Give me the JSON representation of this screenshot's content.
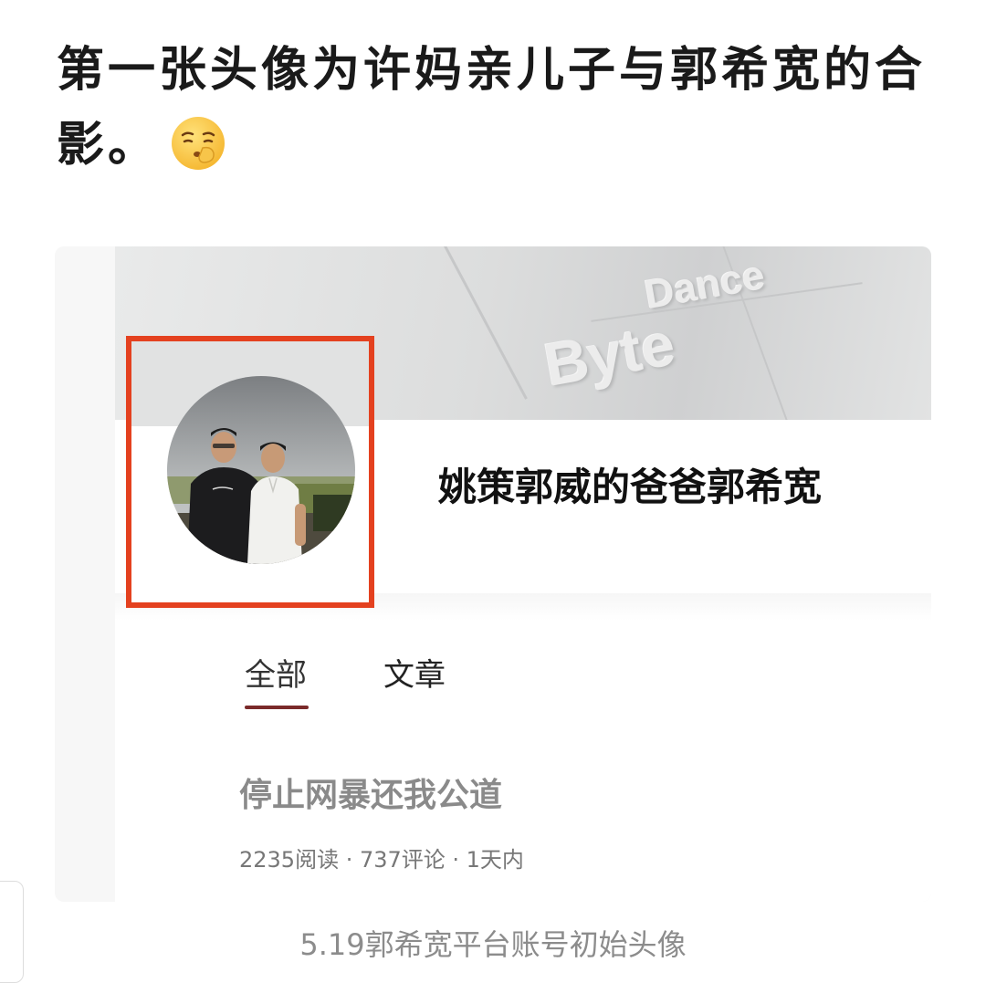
{
  "post": {
    "text": "第一张头像为许妈亲儿子与郭希宽的合影。",
    "emoji": "shushing-face-emoji"
  },
  "screenshot_card": {
    "banner": {
      "word_1": "Dance",
      "word_2": "Byte"
    },
    "profile": {
      "name": "姚策郭威的爸爸郭希宽",
      "avatar": "avatar-two-men-photo"
    },
    "tabs": [
      {
        "label": "全部",
        "active": true
      },
      {
        "label": "文章",
        "active": false
      }
    ],
    "article": {
      "title": "停止网暴还我公道",
      "meta": "2235阅读 · 737评论 · 1天内"
    },
    "highlight_color": "#e4411f",
    "tab_underline_color": "#7a2a2a"
  },
  "caption": "5.19郭希宽平台账号初始头像"
}
